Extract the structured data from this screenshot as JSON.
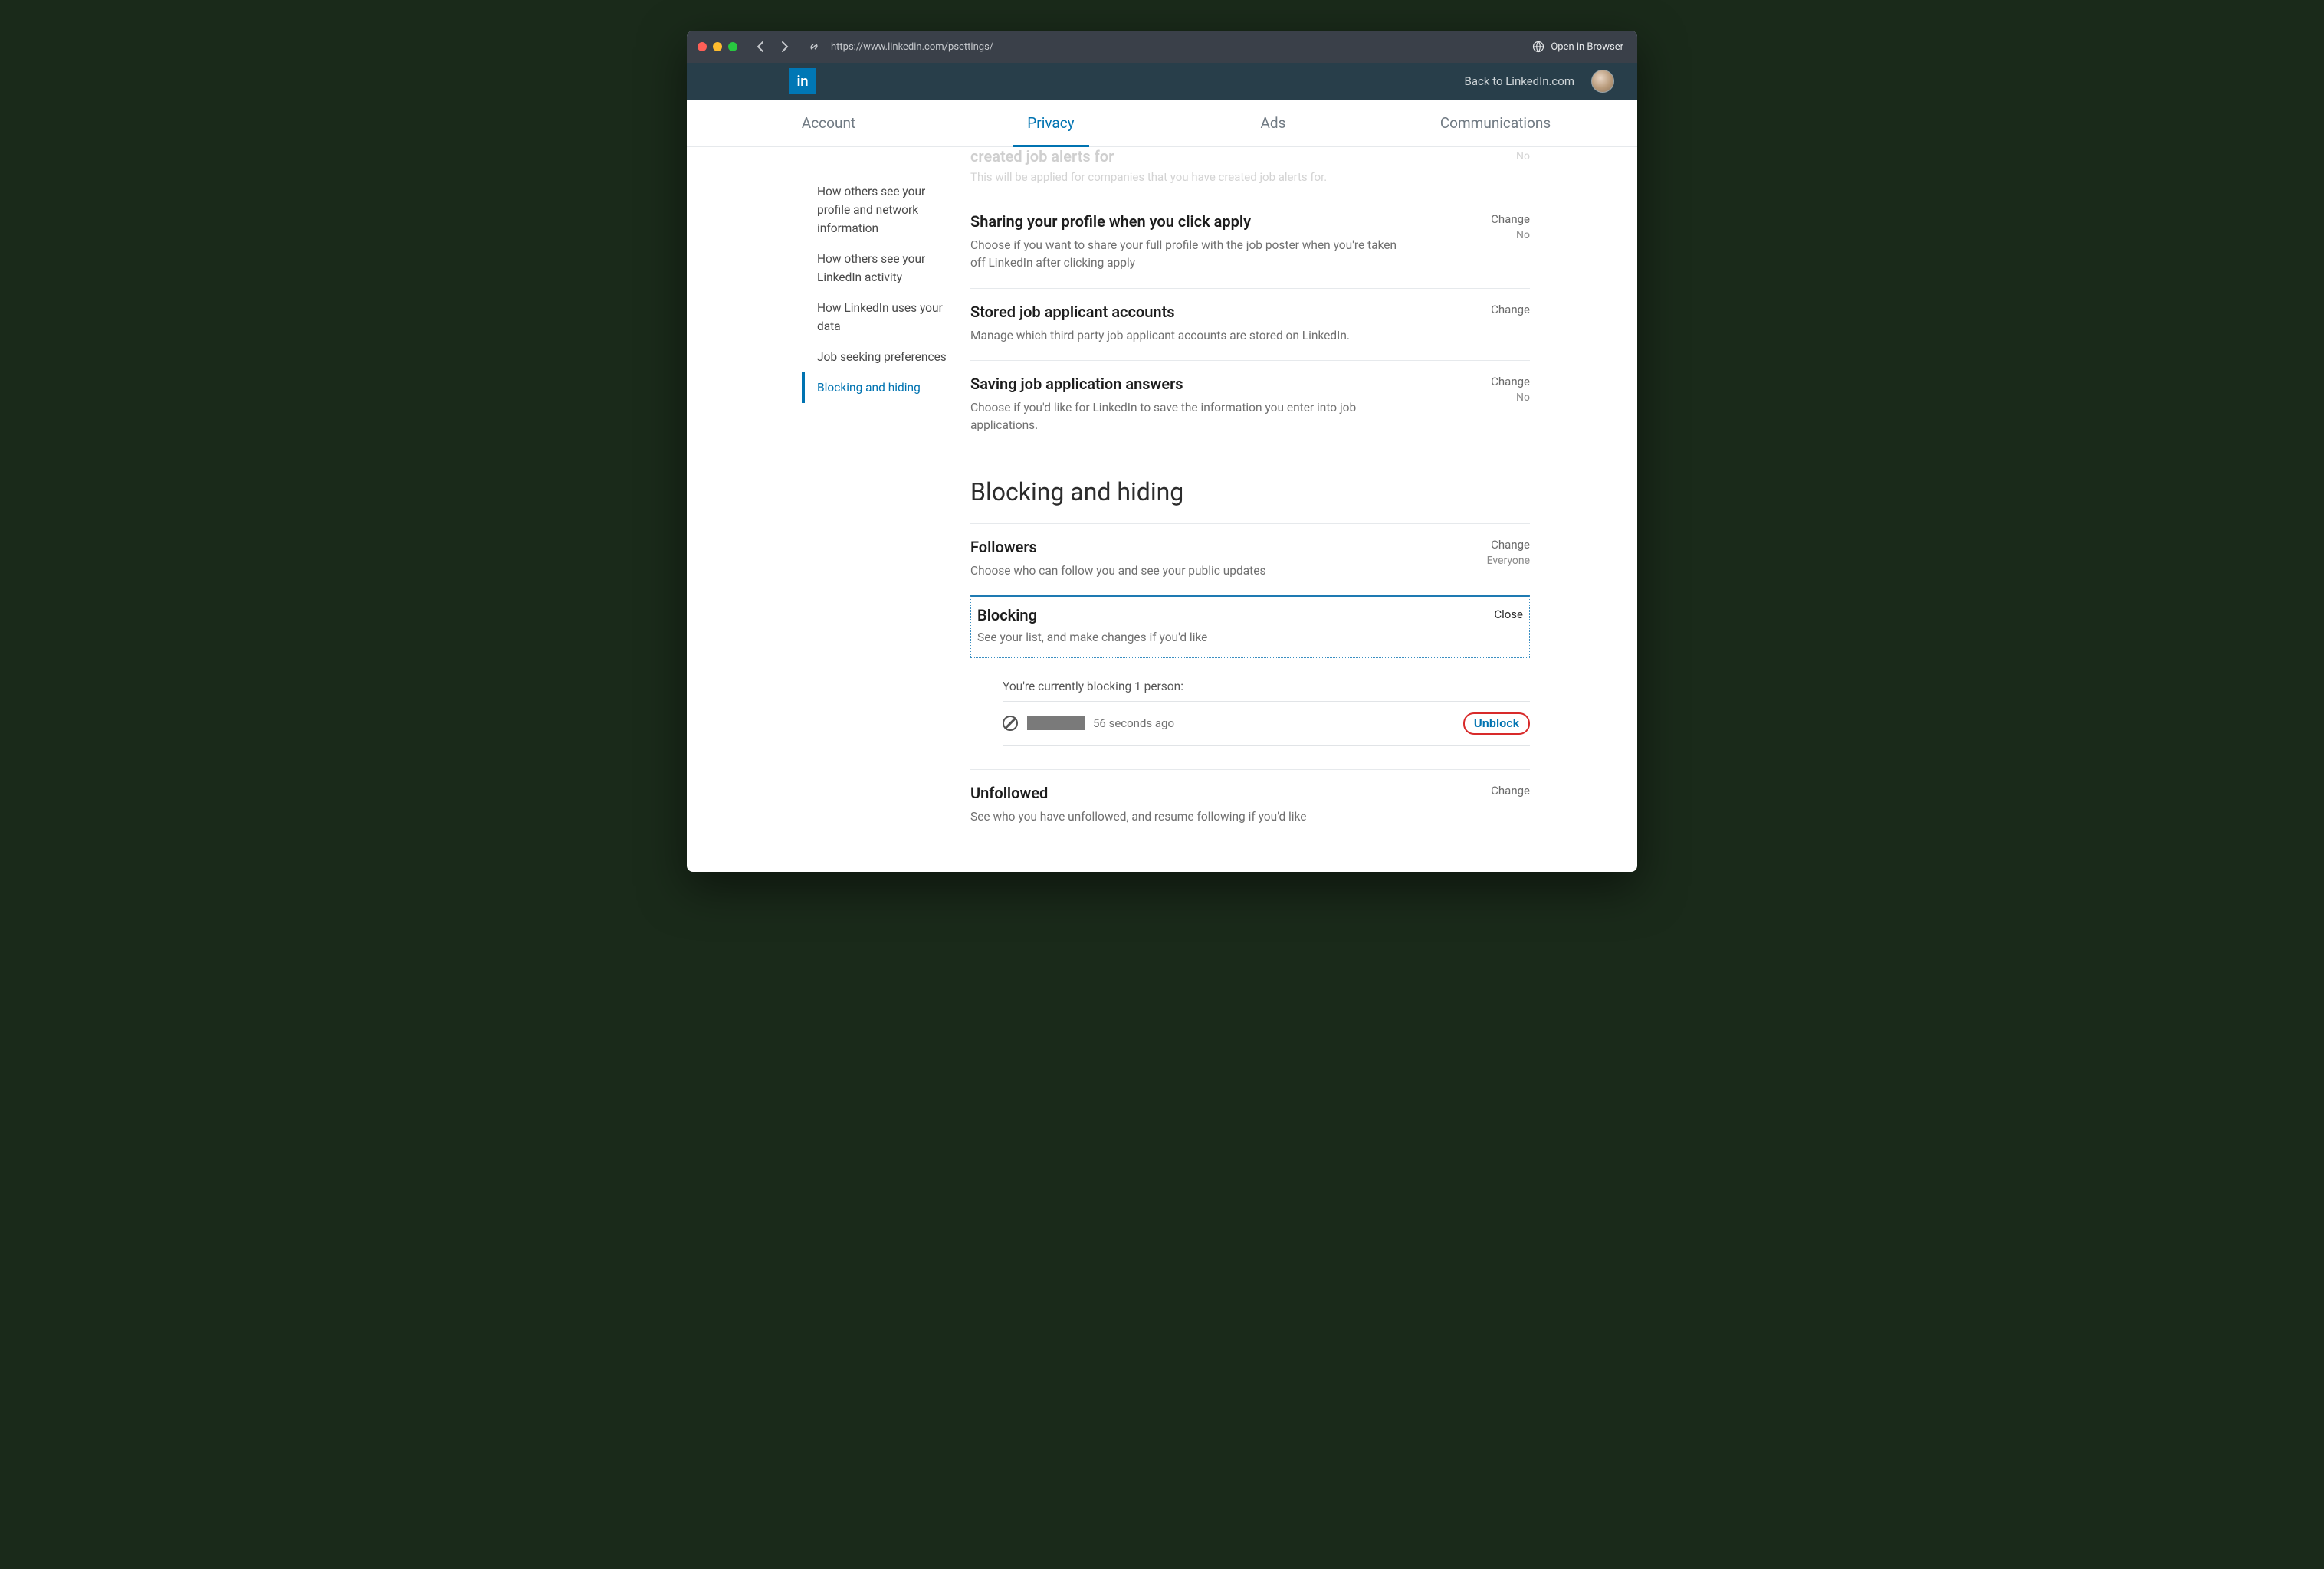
{
  "browser": {
    "url": "https://www.linkedin.com/psettings/",
    "open_label": "Open in Browser"
  },
  "header": {
    "logo_text": "in",
    "back_label": "Back to LinkedIn.com"
  },
  "tabs": {
    "items": [
      {
        "label": "Account"
      },
      {
        "label": "Privacy"
      },
      {
        "label": "Ads"
      },
      {
        "label": "Communications"
      }
    ],
    "activeIndex": 1
  },
  "sidebar": {
    "items": [
      {
        "label": "How others see your profile and network information"
      },
      {
        "label": "How others see your LinkedIn activity"
      },
      {
        "label": "How LinkedIn uses your data"
      },
      {
        "label": "Job seeking preferences"
      },
      {
        "label": "Blocking and hiding"
      }
    ],
    "activeIndex": 4
  },
  "faded": {
    "title": "created job alerts for",
    "desc": "This will be applied for companies that you have created job alerts for.",
    "value": "No"
  },
  "settings": {
    "rows": [
      {
        "title": "Sharing your profile when you click apply",
        "desc": "Choose if you want to share your full profile with the job poster when you're taken off LinkedIn after clicking apply",
        "action": "Change",
        "value": "No"
      },
      {
        "title": "Stored job applicant accounts",
        "desc": "Manage which third party job applicant accounts are stored on LinkedIn.",
        "action": "Change",
        "value": ""
      },
      {
        "title": "Saving job application answers",
        "desc": "Choose if you'd like for LinkedIn to save the information you enter into job applications.",
        "action": "Change",
        "value": "No"
      }
    ]
  },
  "blocking_section": {
    "title": "Blocking and hiding",
    "rows": [
      {
        "title": "Followers",
        "desc": "Choose who can follow you and see your public updates",
        "action": "Change",
        "value": "Everyone"
      }
    ],
    "blocking": {
      "title": "Blocking",
      "desc": "See your list, and make changes if you'd like",
      "action": "Close",
      "list_head": "You're currently blocking 1 person:",
      "entry_time": "56 seconds ago",
      "unblock_label": "Unblock"
    },
    "unfollowed": {
      "title": "Unfollowed",
      "desc": "See who you have unfollowed, and resume following if you'd like",
      "action": "Change"
    }
  }
}
